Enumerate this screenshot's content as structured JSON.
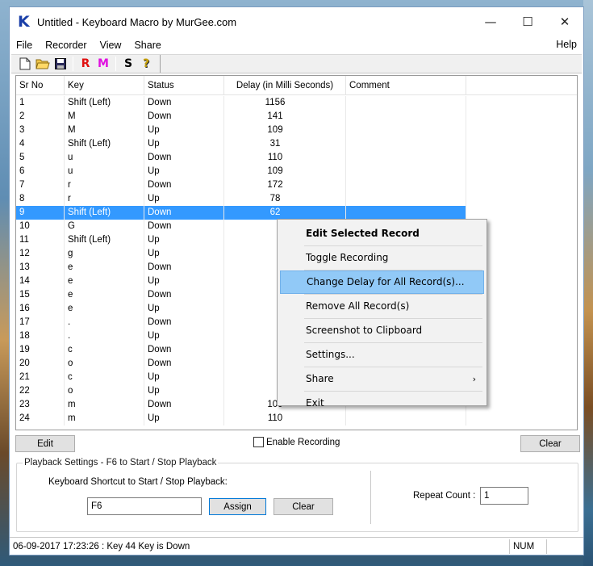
{
  "window": {
    "title": "Untitled - Keyboard Macro by MurGee.com",
    "logo_letter": "K",
    "minimize_glyph": "—",
    "maximize_glyph": "☐",
    "close_glyph": "✕"
  },
  "menu": {
    "items": [
      "File",
      "Recorder",
      "View",
      "Share"
    ],
    "help": "Help"
  },
  "toolbar": {
    "new_glyph": "🗋",
    "open_glyph": "📂",
    "save_glyph": "💾",
    "record_label": "R",
    "record_color": "#e01010",
    "macro_label": "M",
    "macro_color": "#e010e0",
    "settings_label": "S",
    "help_glyph": "?"
  },
  "list": {
    "columns": [
      "Sr No",
      "Key",
      "Status",
      "Delay (in Milli Seconds)",
      "Comment"
    ],
    "rows": [
      {
        "sr": "1",
        "key": "Shift (Left)",
        "status": "Down",
        "delay": "1156",
        "comment": ""
      },
      {
        "sr": "2",
        "key": "M",
        "status": "Down",
        "delay": "141",
        "comment": ""
      },
      {
        "sr": "3",
        "key": "M",
        "status": "Up",
        "delay": "109",
        "comment": ""
      },
      {
        "sr": "4",
        "key": "Shift (Left)",
        "status": "Up",
        "delay": "31",
        "comment": ""
      },
      {
        "sr": "5",
        "key": "u",
        "status": "Down",
        "delay": "110",
        "comment": ""
      },
      {
        "sr": "6",
        "key": "u",
        "status": "Up",
        "delay": "109",
        "comment": ""
      },
      {
        "sr": "7",
        "key": "r",
        "status": "Down",
        "delay": "172",
        "comment": ""
      },
      {
        "sr": "8",
        "key": "r",
        "status": "Up",
        "delay": "78",
        "comment": ""
      },
      {
        "sr": "9",
        "key": "Shift (Left)",
        "status": "Down",
        "delay": "62",
        "comment": "",
        "selected": true
      },
      {
        "sr": "10",
        "key": "G",
        "status": "Down",
        "delay": "",
        "comment": ""
      },
      {
        "sr": "11",
        "key": "Shift (Left)",
        "status": "Up",
        "delay": "",
        "comment": ""
      },
      {
        "sr": "12",
        "key": "g",
        "status": "Up",
        "delay": "",
        "comment": ""
      },
      {
        "sr": "13",
        "key": "e",
        "status": "Down",
        "delay": "",
        "comment": ""
      },
      {
        "sr": "14",
        "key": "e",
        "status": "Up",
        "delay": "",
        "comment": ""
      },
      {
        "sr": "15",
        "key": "e",
        "status": "Down",
        "delay": "",
        "comment": ""
      },
      {
        "sr": "16",
        "key": "e",
        "status": "Up",
        "delay": "",
        "comment": ""
      },
      {
        "sr": "17",
        "key": ".",
        "status": "Down",
        "delay": "",
        "comment": ""
      },
      {
        "sr": "18",
        "key": ".",
        "status": "Up",
        "delay": "",
        "comment": ""
      },
      {
        "sr": "19",
        "key": "c",
        "status": "Down",
        "delay": "",
        "comment": ""
      },
      {
        "sr": "20",
        "key": "o",
        "status": "Down",
        "delay": "",
        "comment": ""
      },
      {
        "sr": "21",
        "key": "c",
        "status": "Up",
        "delay": "",
        "comment": ""
      },
      {
        "sr": "22",
        "key": "o",
        "status": "Up",
        "delay": "",
        "comment": ""
      },
      {
        "sr": "23",
        "key": "m",
        "status": "Down",
        "delay": "109",
        "comment": ""
      },
      {
        "sr": "24",
        "key": "m",
        "status": "Up",
        "delay": "110",
        "comment": ""
      }
    ]
  },
  "context_menu": {
    "items": [
      {
        "label": "Edit Selected Record",
        "bold": true
      },
      {
        "label": "Toggle Recording"
      },
      {
        "label": "Change Delay for All Record(s)...",
        "highlighted": true
      },
      {
        "label": "Remove All Record(s)"
      },
      {
        "label": "Screenshot to Clipboard"
      },
      {
        "label": "Settings..."
      },
      {
        "label": "Share",
        "submenu": true,
        "arrow": "›"
      },
      {
        "label": "Exit"
      }
    ]
  },
  "controls": {
    "edit_label": "Edit",
    "enable_recording_label": "Enable Recording",
    "enable_recording_checked": false,
    "clear_label": "Clear"
  },
  "playback": {
    "group_title": "Playback Settings - F6 to Start / Stop Playback",
    "shortcut_label": "Keyboard Shortcut to Start / Stop Playback:",
    "shortcut_value": "F6",
    "assign_label": "Assign",
    "clear_label": "Clear",
    "repeat_label": "Repeat Count :",
    "repeat_value": "1"
  },
  "status": {
    "text": "06-09-2017 17:23:26 : Key 44 Key is Down",
    "num": "NUM"
  }
}
